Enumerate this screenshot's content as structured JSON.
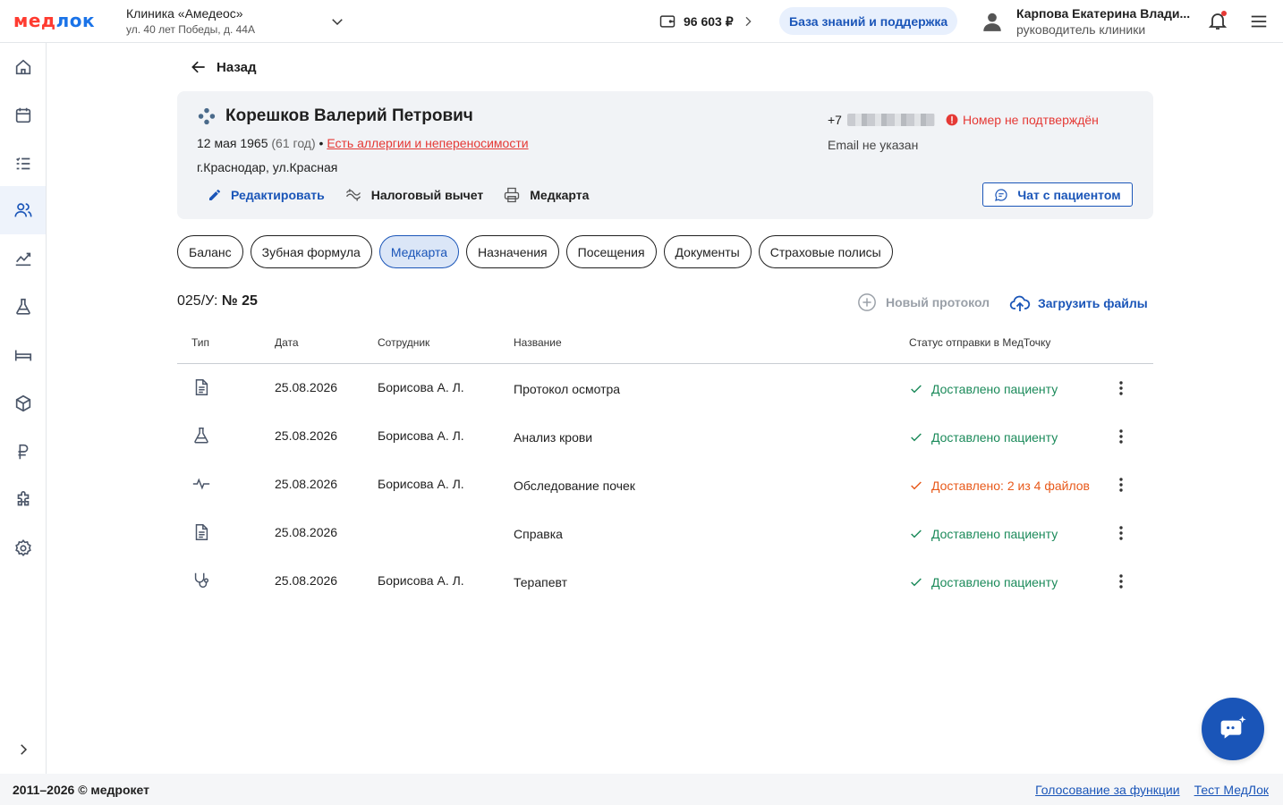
{
  "header": {
    "logo_part1": "мед",
    "logo_part2": "лок",
    "clinic_name": "Клиника «Амедеос»",
    "clinic_address": "ул. 40 лет Победы, д. 44А",
    "balance": "96 603 ₽",
    "knowledge_base": "База знаний и поддержка",
    "user_name": "Карпова Екатерина Влади...",
    "user_role": "руководитель клиники",
    "bell_has_notification": true
  },
  "sidebar": {
    "items": [
      {
        "icon": "home-icon",
        "active": false
      },
      {
        "icon": "calendar-icon",
        "active": false
      },
      {
        "icon": "checklist-icon",
        "active": false
      },
      {
        "icon": "patients-icon",
        "active": true
      },
      {
        "icon": "analytics-icon",
        "active": false
      },
      {
        "icon": "lab-icon",
        "active": false
      },
      {
        "icon": "bed-icon",
        "active": false
      },
      {
        "icon": "box-icon",
        "active": false
      },
      {
        "icon": "ruble-icon",
        "active": false
      },
      {
        "icon": "puzzle-icon",
        "active": false
      },
      {
        "icon": "gear-icon",
        "active": false
      }
    ]
  },
  "back_label": "Назад",
  "patient": {
    "name": "Корешков Валерий Петрович",
    "birth_date": "12 мая 1965",
    "age": "(61 год)",
    "bullet": "•",
    "allergy_link": "Есть аллергии и непереносимости",
    "address": "г.Краснодар, ул.Красная",
    "phone_prefix": "+7",
    "phone_status": "Номер не подтверждён",
    "email": "Email не указан",
    "actions": {
      "edit": "Редактировать",
      "tax": "Налоговый вычет",
      "medcard": "Медкарта"
    },
    "chat_button": "Чат с пациентом"
  },
  "tabs": [
    {
      "label": "Баланс",
      "active": false
    },
    {
      "label": "Зубная формула",
      "active": false
    },
    {
      "label": "Медкарта",
      "active": true
    },
    {
      "label": "Назначения",
      "active": false
    },
    {
      "label": "Посещения",
      "active": false
    },
    {
      "label": "Документы",
      "active": false
    },
    {
      "label": "Страховые полисы",
      "active": false
    }
  ],
  "card_number_prefix": "025/У:",
  "card_number": "№ 25",
  "new_protocol": "Новый протокол",
  "upload_files": "Загрузить файлы",
  "table": {
    "headers": {
      "type": "Тип",
      "date": "Дата",
      "employee": "Сотрудник",
      "name": "Название",
      "status": "Статус отправки в МедТочку"
    },
    "rows": [
      {
        "icon": "document-icon",
        "date": "25.08.2026",
        "employee": "Борисова А. Л.",
        "name": "Протокол осмотра",
        "status": "Доставлено пациенту",
        "status_type": "ok"
      },
      {
        "icon": "flask-icon",
        "date": "25.08.2026",
        "employee": "Борисова А. Л.",
        "name": "Анализ крови",
        "status": "Доставлено пациенту",
        "status_type": "ok"
      },
      {
        "icon": "pulse-icon",
        "date": "25.08.2026",
        "employee": "Борисова А. Л.",
        "name": "Обследование почек",
        "status": "Доставлено: 2 из 4 файлов",
        "status_type": "partial"
      },
      {
        "icon": "document-icon",
        "date": "25.08.2026",
        "employee": "",
        "name": "Справка",
        "status": "Доставлено пациенту",
        "status_type": "ok"
      },
      {
        "icon": "stethoscope-icon",
        "date": "25.08.2026",
        "employee": "Борисова А. Л.",
        "name": "Терапевт",
        "status": "Доставлено пациенту",
        "status_type": "ok"
      }
    ]
  },
  "footer": {
    "copyright": "2011–2026 © медрокет",
    "link_vote": "Голосование за функции",
    "link_test": "Тест МедЛок"
  },
  "colors": {
    "brand_blue": "#1a55b8",
    "brand_red": "#ff3b30",
    "success": "#1b8a5a",
    "warning": "#e8591a"
  }
}
